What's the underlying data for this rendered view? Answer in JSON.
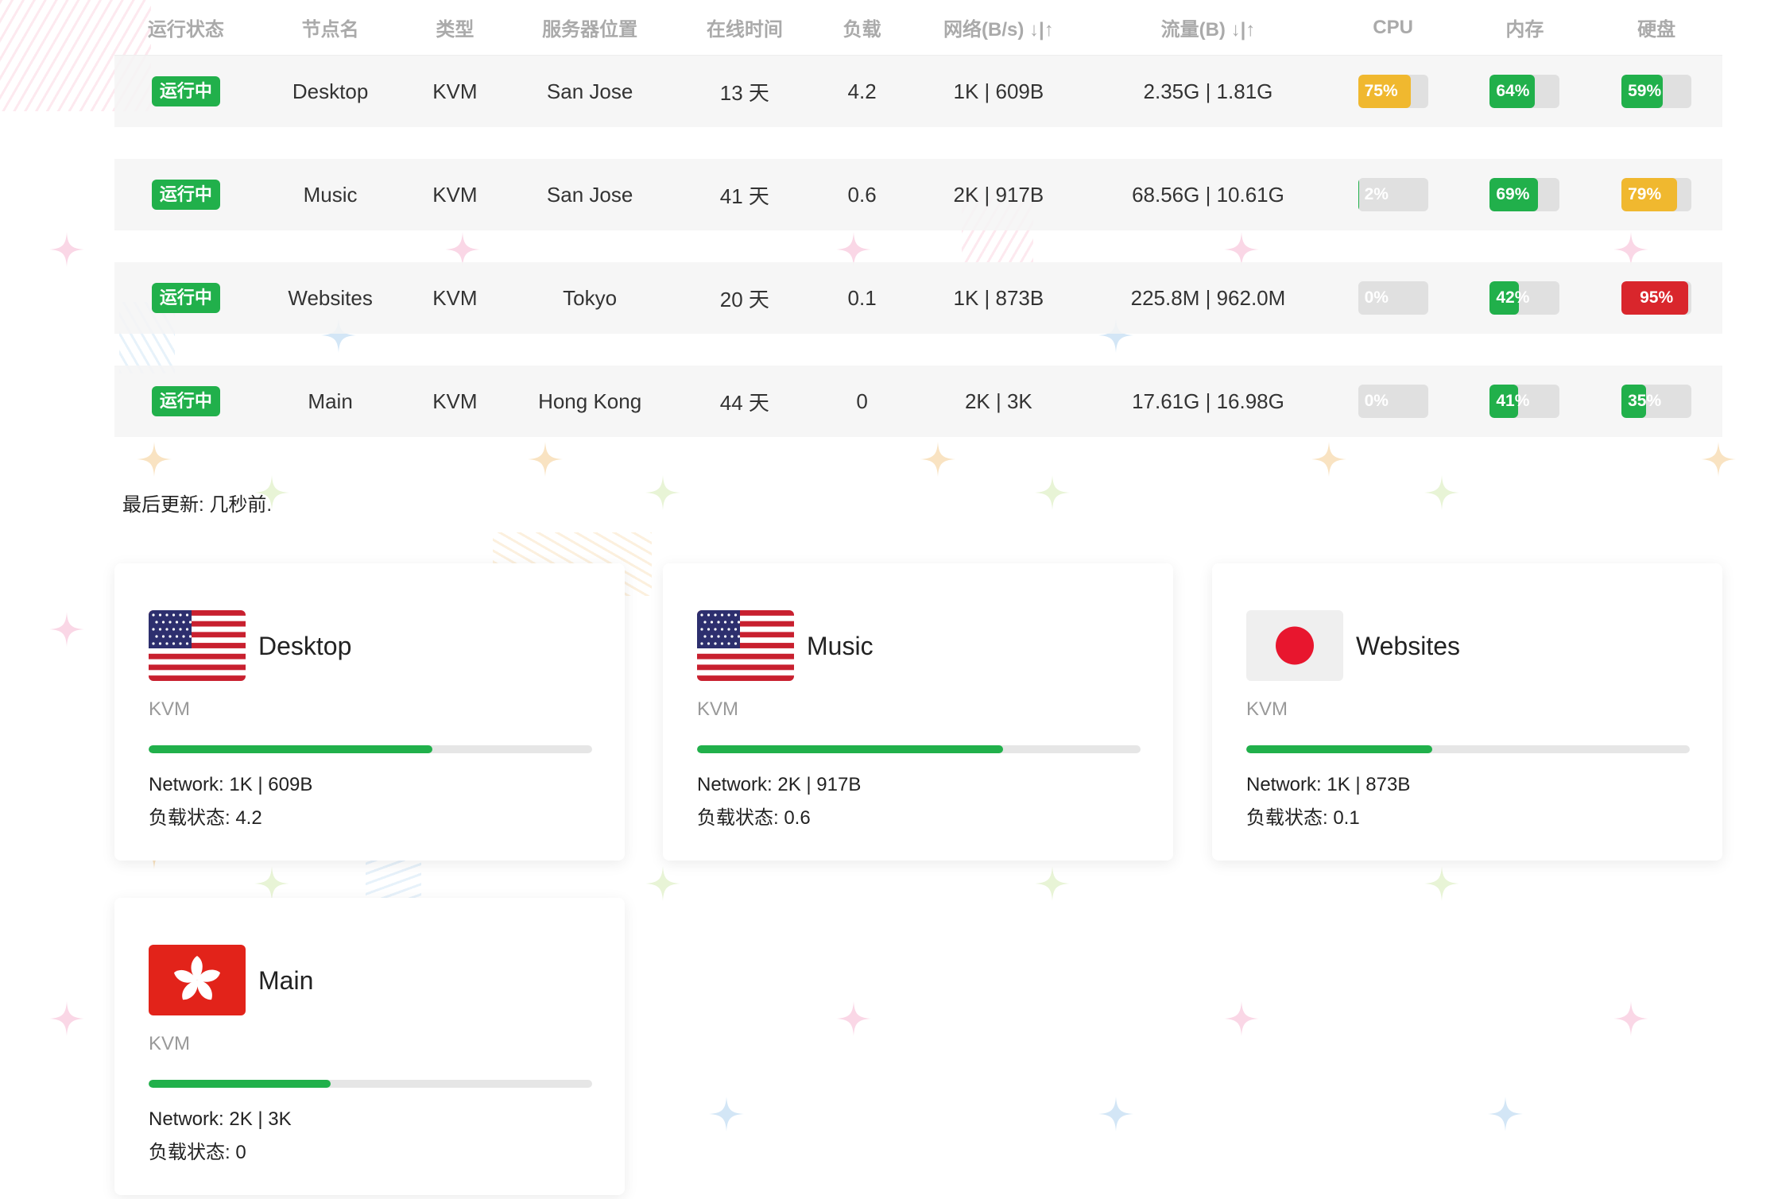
{
  "table": {
    "headers": [
      "运行状态",
      "节点名",
      "类型",
      "服务器位置",
      "在线时间",
      "负载",
      "网络(B/s) ↓|↑",
      "流量(B) ↓|↑",
      "CPU",
      "内存",
      "硬盘"
    ],
    "rows": [
      {
        "status": "运行中",
        "name": "Desktop",
        "type": "KVM",
        "location": "San Jose",
        "uptime": "13 天",
        "load": "4.2",
        "network": "1K | 609B",
        "traffic": "2.35G | 1.81G",
        "cpu": {
          "label": "75%",
          "value": 75,
          "color": "#f0b82f"
        },
        "mem": {
          "label": "64%",
          "value": 64,
          "color": "#21b04b"
        },
        "disk": {
          "label": "59%",
          "value": 59,
          "color": "#21b04b"
        }
      },
      {
        "status": "运行中",
        "name": "Music",
        "type": "KVM",
        "location": "San Jose",
        "uptime": "41 天",
        "load": "0.6",
        "network": "2K | 917B",
        "traffic": "68.56G | 10.61G",
        "cpu": {
          "label": "2%",
          "value": 2,
          "color": "#21b04b"
        },
        "mem": {
          "label": "69%",
          "value": 69,
          "color": "#21b04b"
        },
        "disk": {
          "label": "79%",
          "value": 79,
          "color": "#f0b82f"
        }
      },
      {
        "status": "运行中",
        "name": "Websites",
        "type": "KVM",
        "location": "Tokyo",
        "uptime": "20 天",
        "load": "0.1",
        "network": "1K | 873B",
        "traffic": "225.8M | 962.0M",
        "cpu": {
          "label": "0%",
          "value": 0,
          "color": "#21b04b"
        },
        "mem": {
          "label": "42%",
          "value": 42,
          "color": "#21b04b"
        },
        "disk": {
          "label": "95%",
          "value": 95,
          "color": "#d9262c"
        }
      },
      {
        "status": "运行中",
        "name": "Main",
        "type": "KVM",
        "location": "Hong Kong",
        "uptime": "44 天",
        "load": "0",
        "network": "2K | 3K",
        "traffic": "17.61G | 16.98G",
        "cpu": {
          "label": "0%",
          "value": 0,
          "color": "#21b04b"
        },
        "mem": {
          "label": "41%",
          "value": 41,
          "color": "#21b04b"
        },
        "disk": {
          "label": "35%",
          "value": 35,
          "color": "#21b04b"
        }
      }
    ]
  },
  "last_update": "最后更新: 几秒前.",
  "cards": [
    {
      "name": "Desktop",
      "type": "KVM",
      "flag": "us-flag",
      "network_line": "Network: 1K | 609B",
      "load_line": "负载状态: 4.2",
      "bar_value": 64
    },
    {
      "name": "Music",
      "type": "KVM",
      "flag": "us-flag",
      "network_line": "Network: 2K | 917B",
      "load_line": "负载状态: 0.6",
      "bar_value": 69
    },
    {
      "name": "Websites",
      "type": "KVM",
      "flag": "jp-flag",
      "network_line": "Network: 1K | 873B",
      "load_line": "负载状态: 0.1",
      "bar_value": 42
    },
    {
      "name": "Main",
      "type": "KVM",
      "flag": "hk-flag",
      "network_line": "Network: 2K | 3K",
      "load_line": "负载状态: 0",
      "bar_value": 41
    }
  ],
  "colors": {
    "accent_green": "#21b04b",
    "warn_yellow": "#f0b82f",
    "danger_red": "#d9262c"
  }
}
